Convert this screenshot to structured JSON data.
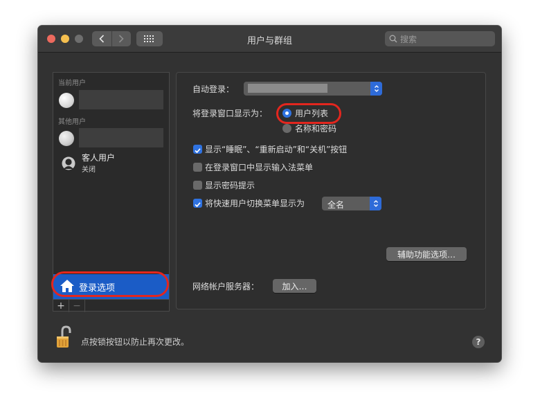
{
  "window": {
    "title": "用户与群组"
  },
  "search": {
    "placeholder": "搜索"
  },
  "sidebar": {
    "current_users_label": "当前用户",
    "other_users_label": "其他用户",
    "guest": {
      "name": "客人用户",
      "status": "关闭"
    },
    "login_options_label": "登录选项",
    "add_label": "+",
    "remove_label": "−"
  },
  "panel": {
    "auto_login_label": "自动登录：",
    "display_login_window_label": "将登录窗口显示为：",
    "radio_user_list": "用户列表",
    "radio_name_password": "名称和密码",
    "checkboxes": [
      {
        "label": "显示“睡眠”、“重新启动”和“关机”按钮",
        "checked": true
      },
      {
        "label": "在登录窗口中显示输入法菜单",
        "checked": false
      },
      {
        "label": "显示密码提示",
        "checked": false
      },
      {
        "label": "将快速用户切换菜单显示为",
        "checked": true
      }
    ],
    "fast_switch_value": "全名",
    "accessibility_button": "辅助功能选项…",
    "network_server_label": "网络帐户服务器：",
    "join_button": "加入…"
  },
  "footer": {
    "lock_text": "点按锁按钮以防止再次更改。",
    "help_label": "?"
  },
  "colors": {
    "accent": "#2f72e0",
    "selection": "#1b5cc6",
    "annotation_ring": "#e3261e"
  },
  "icons": [
    "search-icon",
    "grid-icon",
    "back-icon",
    "forward-icon",
    "house-icon",
    "guest-user-icon",
    "lock-icon",
    "help-icon"
  ]
}
